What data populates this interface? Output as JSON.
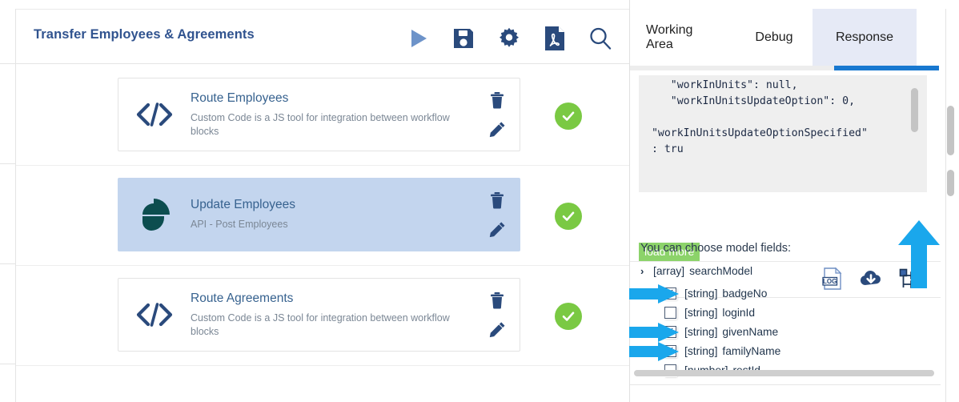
{
  "workflow": {
    "title": "Transfer Employees & Agreements",
    "toolbar": [
      {
        "name": "run-icon",
        "label": "Run"
      },
      {
        "name": "save-icon",
        "label": "Save"
      },
      {
        "name": "gear-icon",
        "label": "Settings"
      },
      {
        "name": "pdf-icon",
        "label": "Export PDF"
      },
      {
        "name": "search-icon",
        "label": "Search"
      }
    ],
    "blocks": [
      {
        "name": "Route Employees",
        "description": "Custom Code is a JS tool for integration between workflow blocks",
        "icon": "code-icon",
        "selected": false,
        "status": "ok",
        "delete_label": "Delete",
        "edit_label": "Edit"
      },
      {
        "name": "Update Employees",
        "description": "API - Post Employees",
        "icon": "api-logo-icon",
        "selected": true,
        "status": "ok",
        "delete_label": "Delete",
        "edit_label": "Edit"
      },
      {
        "name": "Route Agreements",
        "description": "Custom Code is a JS tool for integration between workflow blocks",
        "icon": "code-icon",
        "selected": false,
        "status": "ok",
        "delete_label": "Delete",
        "edit_label": "Edit"
      }
    ]
  },
  "right_panel": {
    "tabs": [
      {
        "label": "Working Area",
        "active": false
      },
      {
        "label": "Debug",
        "active": false
      },
      {
        "label": "Response",
        "active": true
      }
    ],
    "response": {
      "code": "    \"workInUnits\": null,\n    \"workInUnitsUpdateOption\": 0,\n\n \"workInUnitsUpdateOptionSpecified\"\n : tru",
      "load_more_label": "load more",
      "icons": [
        {
          "name": "log-file-icon",
          "label": "LOG"
        },
        {
          "name": "cloud-download-icon",
          "label": "Download"
        },
        {
          "name": "tree-view-icon",
          "label": "Tree view"
        }
      ]
    },
    "model_fields": {
      "caption": "You can choose model fields:",
      "root": {
        "chevron": "›",
        "type": "[array]",
        "name": "searchModel"
      },
      "items": [
        {
          "checked": true,
          "type": "[string]",
          "name": "badgeNo",
          "annotated": true
        },
        {
          "checked": false,
          "type": "[string]",
          "name": "loginId",
          "annotated": false
        },
        {
          "checked": true,
          "type": "[string]",
          "name": "givenName",
          "annotated": true
        },
        {
          "checked": true,
          "type": "[string]",
          "name": "familyName",
          "annotated": true
        },
        {
          "checked": false,
          "type": "[number]",
          "name": "restId",
          "annotated": false
        }
      ]
    }
  },
  "colors": {
    "brand_blue": "#30538f",
    "icon_navy": "#2a4a7c",
    "selected_row": "#c3d5ee",
    "status_green": "#7ac943",
    "load_more_green": "#8cd36a",
    "tab_active_bg": "#e6eaf6",
    "tab_underline": "#1878d0",
    "annotation_arrow": "#1aa7ec",
    "api_logo_teal": "#0c4d4f"
  }
}
